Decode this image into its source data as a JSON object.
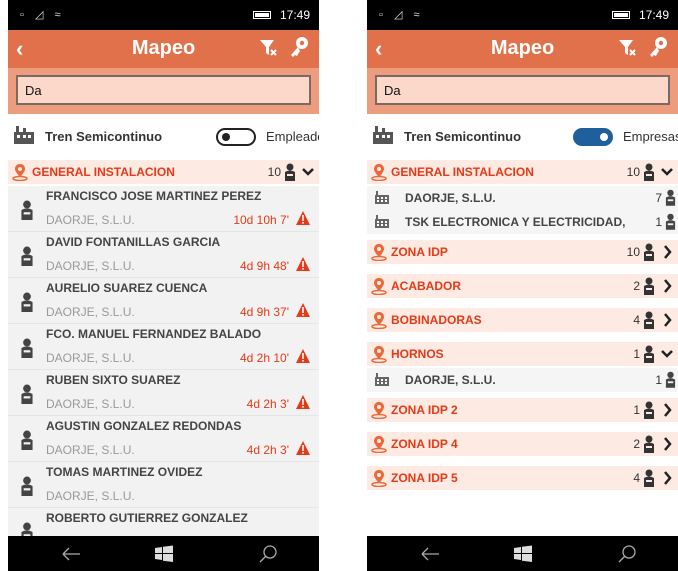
{
  "left": {
    "status": {
      "time": "17:49"
    },
    "appbar": {
      "title": "Mapeo"
    },
    "search": {
      "value": "Da"
    },
    "filter": {
      "label": "Tren Semicontinuo",
      "option_label": "Empleados",
      "toggle_on": false
    },
    "group": {
      "name": "GENERAL INSTALACION",
      "count": "10"
    },
    "people": [
      {
        "name": "FRANCISCO JOSE MARTINEZ PEREZ",
        "company": "DAORJE, S.L.U.",
        "time": "10d 10h 7'",
        "warning": true
      },
      {
        "name": "DAVID FONTANILLAS GARCIA",
        "company": "DAORJE, S.L.U.",
        "time": "4d 9h 48'",
        "warning": true
      },
      {
        "name": "AURELIO SUAREZ CUENCA",
        "company": "DAORJE, S.L.U.",
        "time": "4d 9h 37'",
        "warning": true
      },
      {
        "name": "FCO. MANUEL FERNANDEZ BALADO",
        "company": "DAORJE, S.L.U.",
        "time": "4d 2h 10'",
        "warning": true
      },
      {
        "name": "RUBEN SIXTO SUAREZ",
        "company": "DAORJE, S.L.U.",
        "time": "4d 2h 3'",
        "warning": true
      },
      {
        "name": "AGUSTIN GONZALEZ REDONDAS",
        "company": "DAORJE, S.L.U.",
        "time": "4d 2h 3'",
        "warning": true
      },
      {
        "name": "TOMAS MARTINEZ OVIDEZ",
        "company": "DAORJE, S.L.U.",
        "time": "",
        "warning": false
      },
      {
        "name": "ROBERTO GUTIERREZ GONZALEZ",
        "company": "",
        "time": "",
        "warning": false
      }
    ]
  },
  "right": {
    "status": {
      "time": "17:49"
    },
    "appbar": {
      "title": "Mapeo"
    },
    "search": {
      "value": "Da"
    },
    "filter": {
      "label": "Tren Semicontinuo",
      "option_label": "Empresas",
      "toggle_on": true
    },
    "groups": [
      {
        "name": "GENERAL INSTALACION",
        "count": "10",
        "expanded": true,
        "companies": [
          {
            "name": "DAORJE, S.L.U.",
            "count": "7"
          },
          {
            "name": "TSK ELECTRONICA Y ELECTRICIDAD,",
            "count": "1"
          }
        ]
      },
      {
        "name": "ZONA IDP",
        "count": "10",
        "expanded": false,
        "companies": []
      },
      {
        "name": "ACABADOR",
        "count": "2",
        "expanded": false,
        "companies": []
      },
      {
        "name": "BOBINADORAS",
        "count": "4",
        "expanded": false,
        "companies": []
      },
      {
        "name": "HORNOS",
        "count": "1",
        "expanded": true,
        "companies": [
          {
            "name": "DAORJE, S.L.U.",
            "count": "1"
          }
        ]
      },
      {
        "name": "ZONA IDP 2",
        "count": "1",
        "expanded": false,
        "companies": []
      },
      {
        "name": "ZONA IDP 4",
        "count": "2",
        "expanded": false,
        "companies": []
      },
      {
        "name": "ZONA IDP 5",
        "count": "4",
        "expanded": false,
        "companies": []
      }
    ]
  },
  "icons": {
    "status": [
      "notification-icon",
      "signal-icon",
      "wifi-icon",
      "battery-icon"
    ],
    "appbar": [
      "back-arrow-icon",
      "filter-icon",
      "key-icon"
    ],
    "nav": [
      "back-nav-icon",
      "windows-start-icon",
      "search-nav-icon"
    ]
  },
  "colors": {
    "accent": "#e0714a",
    "search_band": "#ee9c7e",
    "group_text": "#e53a18",
    "toggle_on": "#1f5f9c"
  }
}
